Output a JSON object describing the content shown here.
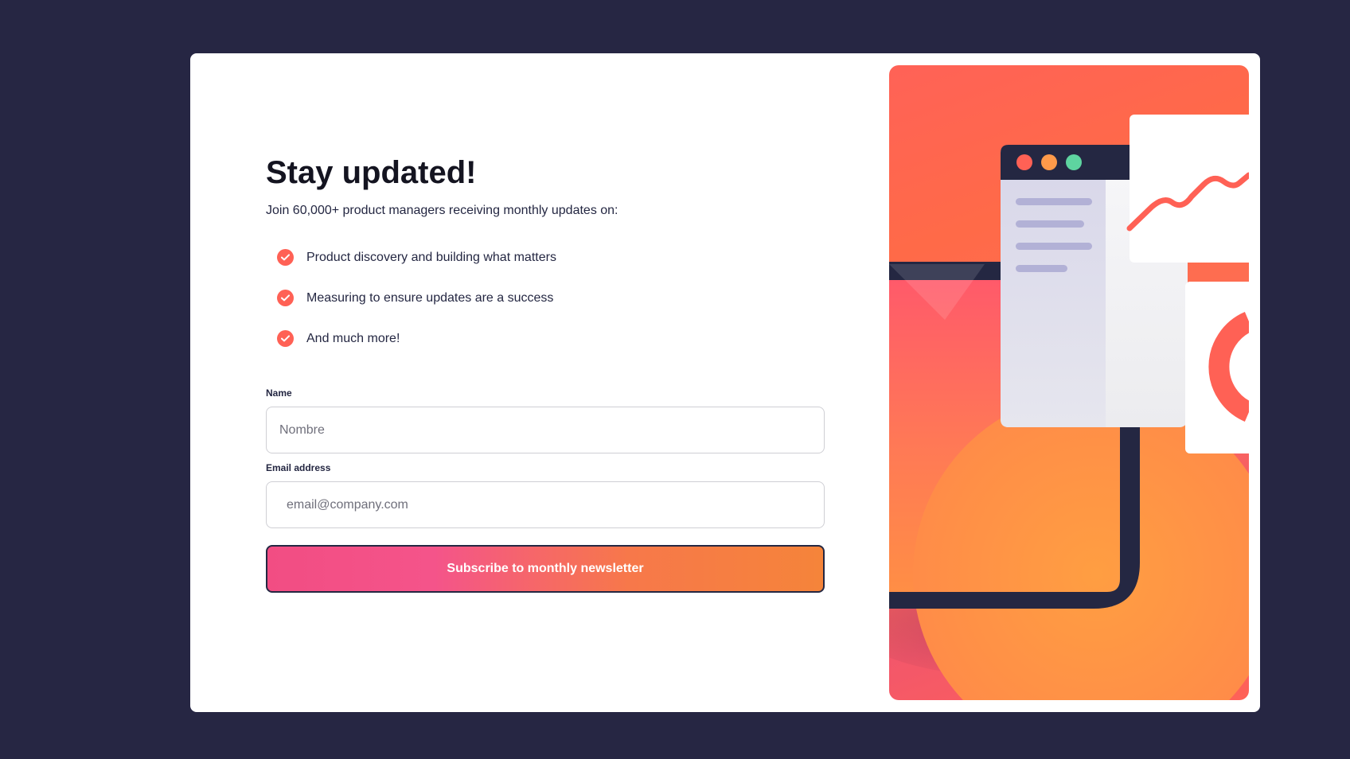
{
  "signup": {
    "title": "Stay updated!",
    "intro": "Join 60,000+ product managers receiving monthly updates on:",
    "features": [
      {
        "text": "Product discovery and building what matters"
      },
      {
        "text": "Measuring to ensure updates are a success"
      },
      {
        "text": "And much more!"
      }
    ],
    "form": {
      "name_label": "Name",
      "name_placeholder": "Nombre",
      "name_value": "",
      "email_label": "Email address",
      "email_placeholder": "email@company.com",
      "email_value": "",
      "submit_label": "Subscribe to monthly newsletter"
    }
  },
  "illustration": {
    "window_dots": [
      "close-dot",
      "minimize-dot",
      "maximize-dot"
    ]
  },
  "colors": {
    "page_background": "#262643",
    "card_background": "#ffffff",
    "accent_tomato": "#ff6155",
    "text_dark": "#242742",
    "button_gradient_start": "#f24d83",
    "button_gradient_end": "#f5843a",
    "dot_red": "#ff6155",
    "dot_orange": "#ff9a4a",
    "dot_green": "#5ed4a0"
  }
}
